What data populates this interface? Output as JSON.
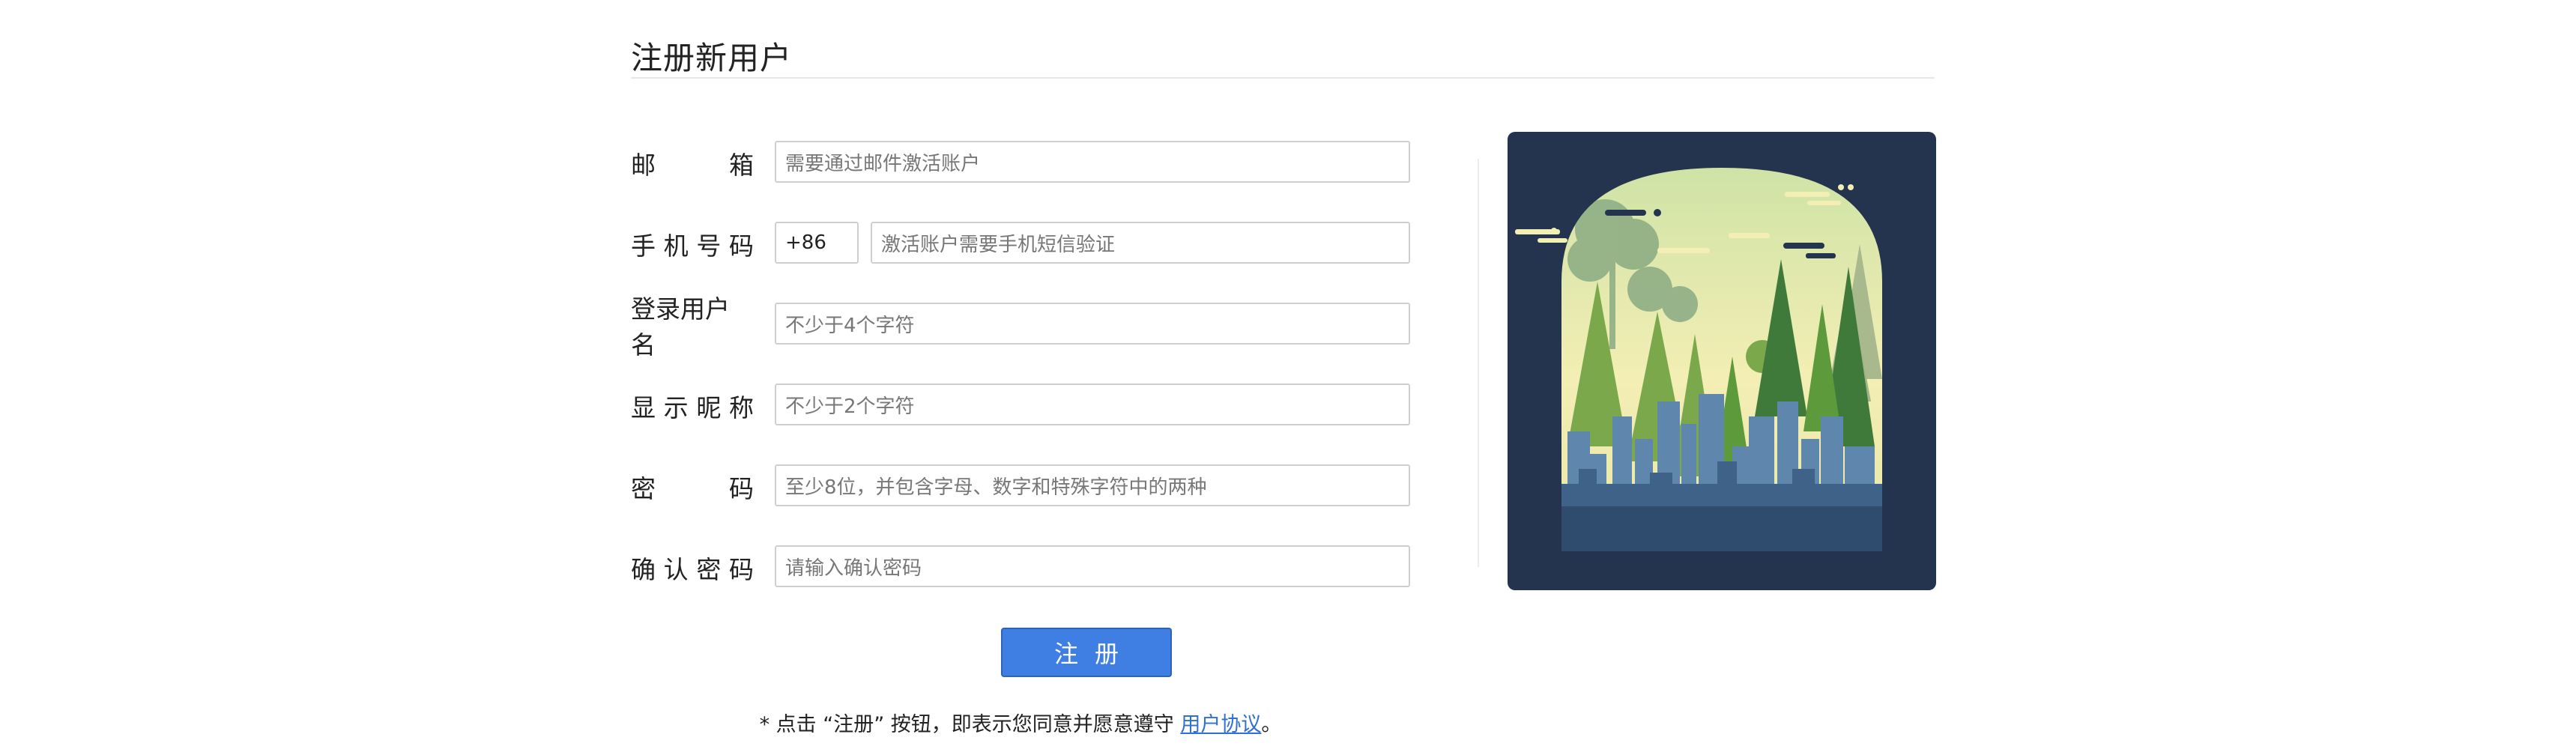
{
  "page_title": "注册新用户",
  "form": {
    "email": {
      "label_chars": [
        "邮",
        "箱"
      ],
      "placeholder": "需要通过邮件激活账户"
    },
    "phone": {
      "label_chars": [
        "手",
        "机",
        "号",
        "码"
      ],
      "country_code": "+86",
      "placeholder": "激活账户需要手机短信验证"
    },
    "username": {
      "label": "登录用户名",
      "placeholder": "不少于4个字符"
    },
    "nickname": {
      "label_chars": [
        "显",
        "示",
        "昵",
        "称"
      ],
      "placeholder": "不少于2个字符"
    },
    "password": {
      "label_chars": [
        "密",
        "码"
      ],
      "placeholder": "至少8位，并包含字母、数字和特殊字符中的两种"
    },
    "confirm": {
      "label_chars": [
        "确",
        "认",
        "密",
        "码"
      ],
      "placeholder": "请输入确认密码"
    }
  },
  "submit_label": "注册",
  "notice": {
    "prefix": "* 点击 “注册” 按钮，即表示您同意并愿意遵守",
    "link": "用户协议",
    "suffix": "。"
  },
  "colors": {
    "accent": "#3f7fe3",
    "link": "#2f6fd8",
    "art_background": "#24344e"
  }
}
